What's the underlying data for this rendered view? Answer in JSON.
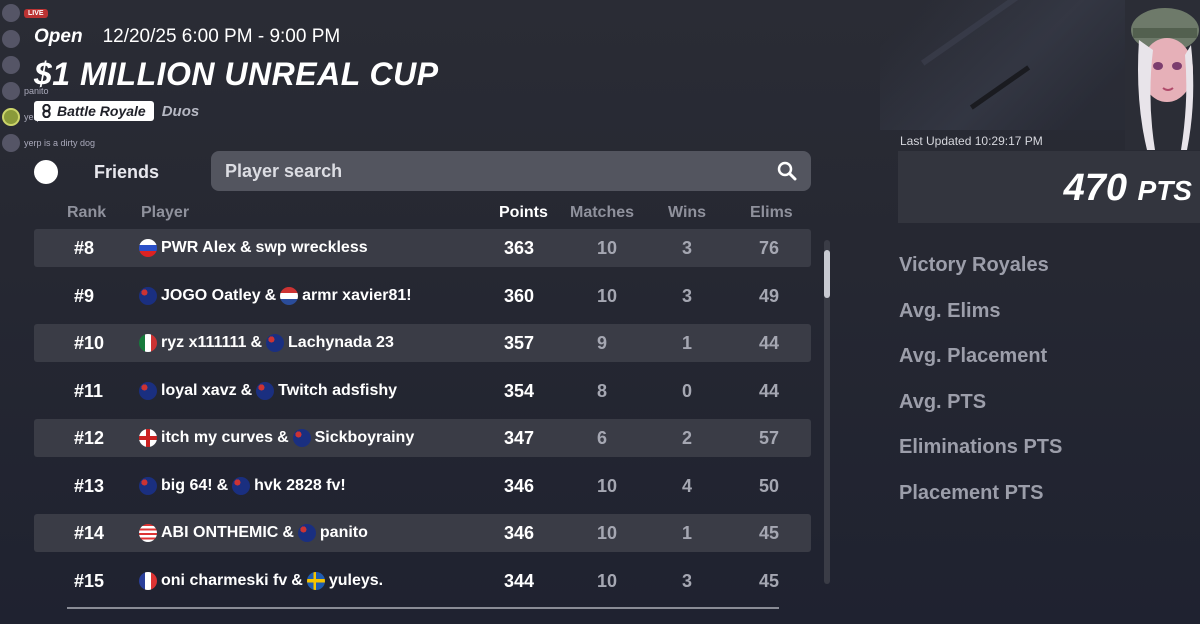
{
  "chat": {
    "live": "LIVE",
    "lines": [
      "",
      "",
      "",
      "panito",
      "yerp",
      "yerp is a dirty dog"
    ]
  },
  "event": {
    "status": "Open",
    "schedule": "12/20/25 6:00 PM - 9:00 PM",
    "title": "$1 MILLION UNREAL CUP",
    "mode": "Battle Royale",
    "team_size": "Duos"
  },
  "filters": {
    "friends_label": "Friends",
    "search_placeholder": "Player search"
  },
  "table": {
    "headers": {
      "rank": "Rank",
      "player": "Player",
      "points": "Points",
      "matches": "Matches",
      "wins": "Wins",
      "elims": "Elims"
    },
    "rows": [
      {
        "rank": "#8",
        "p1_flag": "ru",
        "p1": "PWR Alex",
        "sep": "&",
        "p2_flag": "",
        "p2": "swp wreckless",
        "points": "363",
        "matches": "10",
        "wins": "3",
        "elims": "76"
      },
      {
        "rank": "#9",
        "p1_flag": "au",
        "p1": "JOGO Oatley",
        "sep": "&",
        "p2_flag": "nl",
        "p2": "armr xavier81!",
        "points": "360",
        "matches": "10",
        "wins": "3",
        "elims": "49"
      },
      {
        "rank": "#10",
        "p1_flag": "mx",
        "p1": "ryz x111111",
        "sep": "&",
        "p2_flag": "au",
        "p2": "Lachynada 23",
        "points": "357",
        "matches": "9",
        "wins": "1",
        "elims": "44"
      },
      {
        "rank": "#11",
        "p1_flag": "au",
        "p1": "loyal xavz",
        "sep": "&",
        "p2_flag": "au",
        "p2": "Twitch adsfishy",
        "points": "354",
        "matches": "8",
        "wins": "0",
        "elims": "44"
      },
      {
        "rank": "#12",
        "p1_flag": "en",
        "p1": "itch my curves",
        "sep": "&",
        "p2_flag": "au",
        "p2": "Sickboyrainy",
        "points": "347",
        "matches": "6",
        "wins": "2",
        "elims": "57"
      },
      {
        "rank": "#13",
        "p1_flag": "au",
        "p1": "big 64!",
        "sep": "&",
        "p2_flag": "au",
        "p2": "hvk 2828 fv!",
        "points": "346",
        "matches": "10",
        "wins": "4",
        "elims": "50"
      },
      {
        "rank": "#14",
        "p1_flag": "us",
        "p1": "ABI ONTHEMIC",
        "sep": "&",
        "p2_flag": "au",
        "p2": "panito",
        "points": "346",
        "matches": "10",
        "wins": "1",
        "elims": "45"
      },
      {
        "rank": "#15",
        "p1_flag": "fr",
        "p1": "oni charmeski fv",
        "sep": "&",
        "p2_flag": "se",
        "p2": "yuleys.",
        "points": "344",
        "matches": "10",
        "wins": "3",
        "elims": "45"
      }
    ]
  },
  "summary": {
    "last_updated": "Last Updated 10:29:17 PM",
    "score_value": "470",
    "score_unit": "PTS",
    "stats": [
      "Victory Royales",
      "Avg. Elims",
      "Avg. Placement",
      "Avg. PTS",
      "Eliminations PTS",
      "Placement PTS"
    ]
  }
}
